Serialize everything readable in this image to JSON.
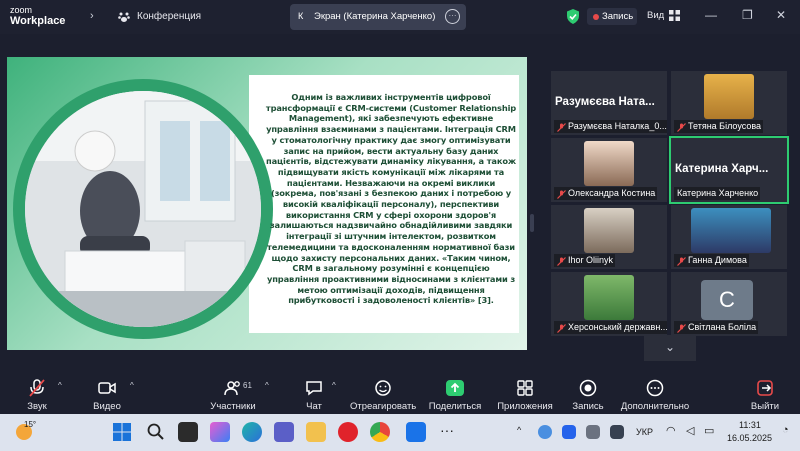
{
  "topbar": {
    "app_line1": "zoom",
    "app_line2": "Workplace",
    "meeting_label": "Конференция",
    "screen_initial": "К",
    "screen_title": "Экран (Катерина Харченко)",
    "recording_label": "Запись",
    "view_label": "Вид",
    "shield_color": "#2ecc71",
    "record_color": "#e84a4a"
  },
  "slide": {
    "text": "Одним із важливих інструментів цифрової трансформації є CRM-системи (Customer Relationship Management), які забезпечують ефективне управління взаєминами з пацієнтами. Інтеграція CRM у стоматологічну практику дає змогу оптимізувати запис на прийом, вести актуальну базу даних пацієнтів, відстежувати динаміку лікування, а також підвищувати якість комунікації між лікарями та пацієнтами. Незважаючи на окремі виклики (зокрема, пов'язані з безпекою даних і потребою у високій кваліфікації персоналу), перспективи використання CRM у сфері охорони здоров'я залишаються надзвичайно обнадійливими завдяки інтеграції зі штучним інтелектом, розвитком телемедицини та вдосконаленням нормативної бази щодо захисту персональних даних. «Таким чином, CRM в загальному розумінні є концепцією управління проактивними відносинами з клієнтами з метою оптимізації доходів, підвищення прибутковості і задоволеності клієнтів» [3].",
    "accent_color": "#3fb27c",
    "text_color": "#1e4f36"
  },
  "gallery": {
    "tiles": [
      {
        "big_name": "Разумєєва Ната...",
        "name": "Разумєєва Наталка_0...",
        "muted": true,
        "kind": "name"
      },
      {
        "big_name": "",
        "name": "Тетяна Білоусова",
        "muted": true,
        "kind": "photo"
      },
      {
        "big_name": "",
        "name": "Олександра Костина",
        "muted": true,
        "kind": "photo"
      },
      {
        "big_name": "Катерина Харч...",
        "name": "Катерина Харченко",
        "muted": false,
        "kind": "name"
      },
      {
        "big_name": "",
        "name": "Ihor Oliinyk",
        "muted": true,
        "kind": "photo"
      },
      {
        "big_name": "",
        "name": "Ганна Димова",
        "muted": true,
        "kind": "photo"
      },
      {
        "big_name": "",
        "name": "Херсонський державн...",
        "muted": true,
        "kind": "photo"
      },
      {
        "big_name": "",
        "name": "Світлана Боліла",
        "muted": true,
        "kind": "avatar",
        "initial": "С"
      }
    ]
  },
  "toolbar": {
    "audio": "Звук",
    "video": "Видео",
    "participants": "Участники",
    "participants_count": "61",
    "chat": "Чат",
    "react": "Отреагировать",
    "share": "Поделиться",
    "apps": "Приложения",
    "record": "Запись",
    "more": "Дополнительно",
    "leave": "Выйти",
    "share_color": "#2ecc71",
    "leave_color": "#e84a4a"
  },
  "taskbar": {
    "weather": "15°",
    "lang": "УКР",
    "time": "11:31",
    "date": "16.05.2025"
  }
}
